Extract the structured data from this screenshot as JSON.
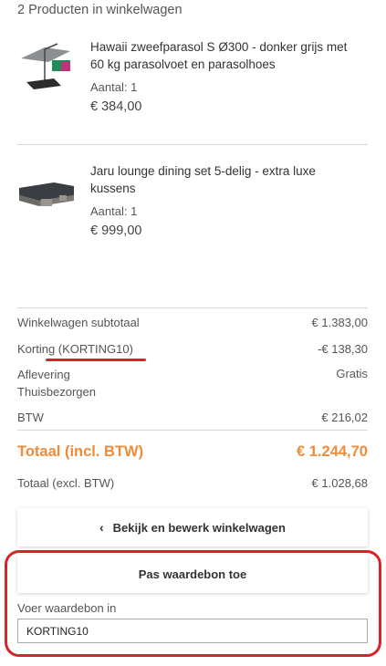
{
  "cart": {
    "header": "2 Producten in winkelwagen"
  },
  "products": [
    {
      "name": "Hawaii zweefparasol S Ø300 - donker grijs met 60 kg parasolvoet en parasolhoes",
      "qty": "Aantal: 1",
      "price": "€ 384,00"
    },
    {
      "name": "Jaru lounge dining set 5-delig - extra luxe kussens",
      "qty": "Aantal: 1",
      "price": "€ 999,00"
    }
  ],
  "summary": {
    "subtotal_label": "Winkelwagen subtotaal",
    "subtotal_value": "€ 1.383,00",
    "discount_label_prefix": "Korting (",
    "discount_code": "KORTING10",
    "discount_label_suffix": ")",
    "discount_value": "-€ 138,30",
    "delivery_label": "Aflevering",
    "delivery_method": "Thuisbezorgen",
    "delivery_value": "Gratis",
    "tax_label": "BTW",
    "tax_value": "€ 216,02",
    "total_incl_label": "Totaal (incl. BTW)",
    "total_incl_value": "€ 1.244,70",
    "total_excl_label": "Totaal (excl. BTW)",
    "total_excl_value": "€ 1.028,68"
  },
  "actions": {
    "edit_cart_label": "Bekijk en bewerk winkelwagen",
    "apply_voucher_label": "Pas waardebon toe"
  },
  "voucher": {
    "label": "Voer waardebon in",
    "value": "KORTING10"
  },
  "colors": {
    "accent": "#f08b3a",
    "highlight": "#d9232a"
  }
}
